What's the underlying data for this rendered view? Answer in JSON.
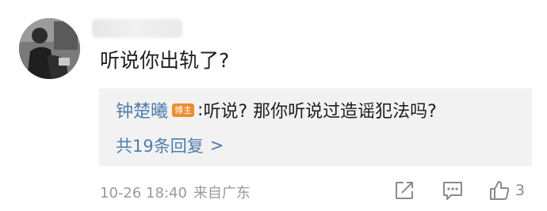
{
  "comment": {
    "text": "听说你出轨了?"
  },
  "reply": {
    "author": "钟楚曦",
    "badge": "博主",
    "separator": ":",
    "text": "听说? 那你听说过造谣犯法吗?",
    "count_label": "共19条回复",
    "chevron": ">"
  },
  "meta": {
    "time": "10-26 18:40",
    "location": "来自广东"
  },
  "actions": {
    "like_count": "3"
  },
  "icons": {
    "share": "share-icon",
    "comment": "comment-icon",
    "like": "thumbs-up-icon"
  },
  "colors": {
    "link_blue": "#4f7dab",
    "badge_orange": "#ef8b2e",
    "reply_bg": "#f2f2f2",
    "meta_gray": "#9a9a9a"
  }
}
